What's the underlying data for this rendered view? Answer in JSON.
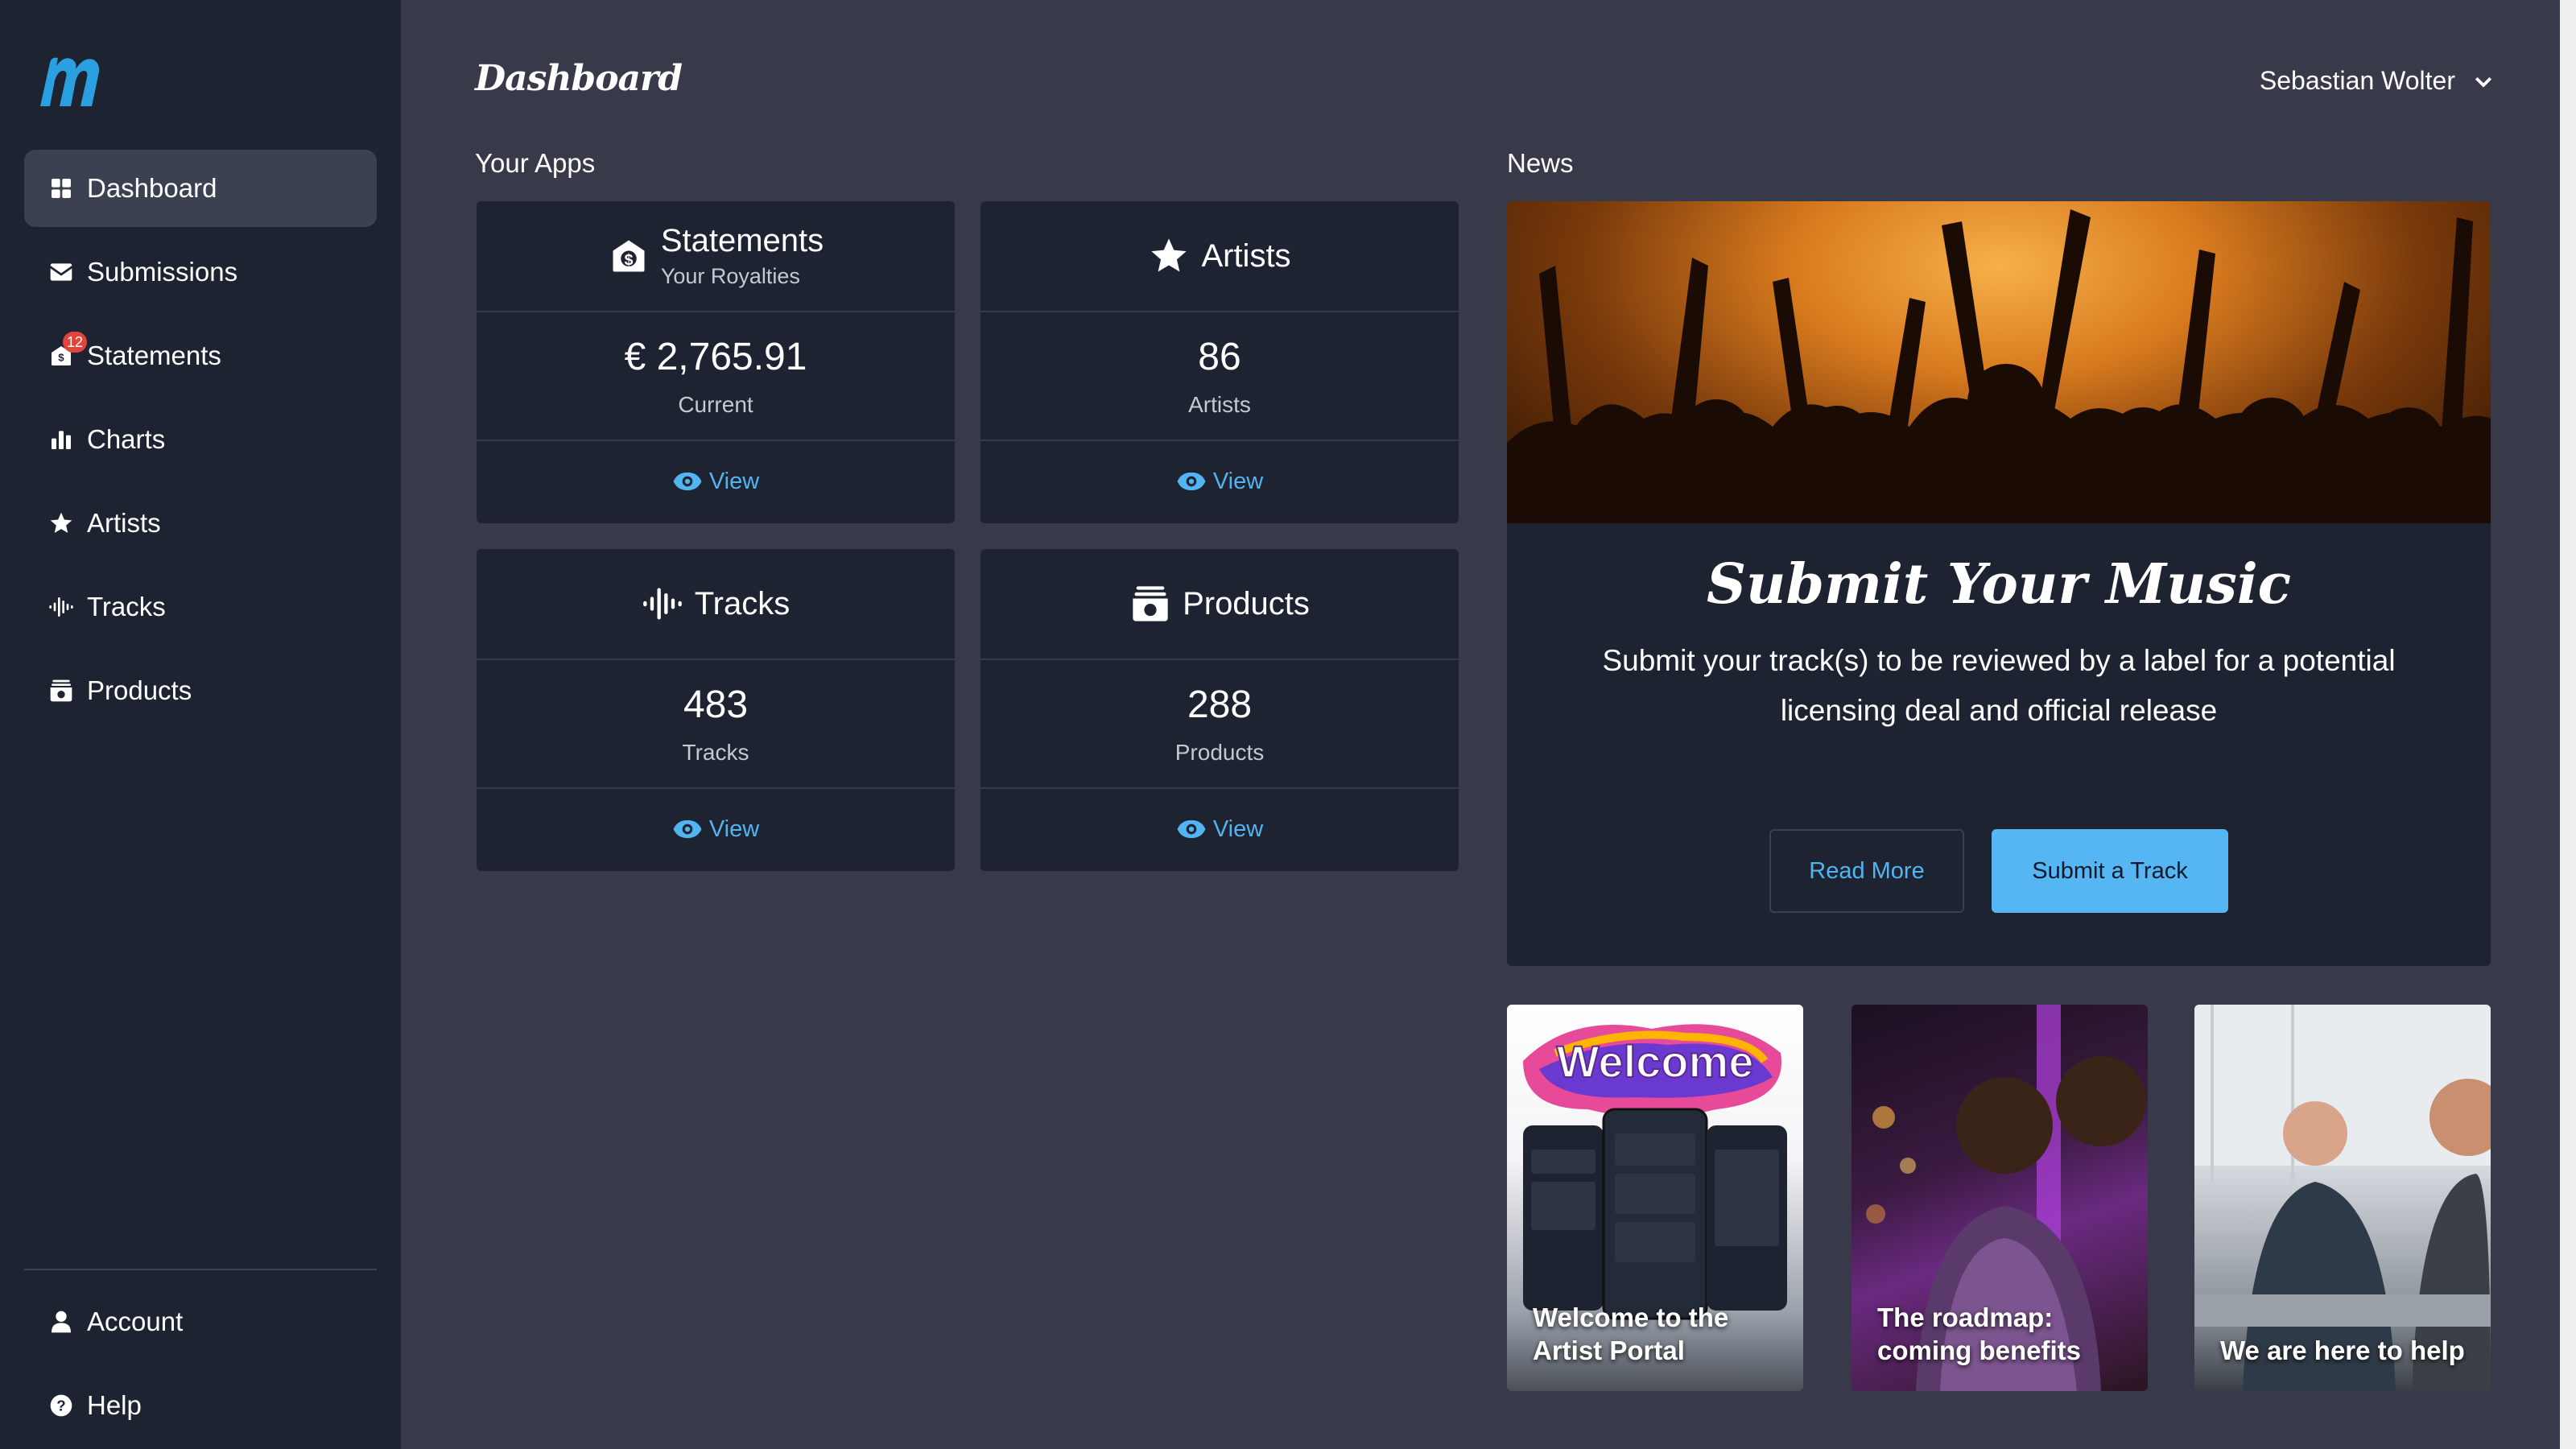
{
  "app": {
    "logo_text": "m"
  },
  "sidebar": {
    "items": [
      {
        "label": "Dashboard",
        "icon": "grid-icon",
        "active": true
      },
      {
        "label": "Submissions",
        "icon": "envelope-icon"
      },
      {
        "label": "Statements",
        "icon": "money-envelope-icon",
        "badge": "12"
      },
      {
        "label": "Charts",
        "icon": "bar-chart-icon"
      },
      {
        "label": "Artists",
        "icon": "star-icon"
      },
      {
        "label": "Tracks",
        "icon": "waveform-icon"
      },
      {
        "label": "Products",
        "icon": "box-icon"
      }
    ],
    "bottom": [
      {
        "label": "Account",
        "icon": "user-icon"
      },
      {
        "label": "Help",
        "icon": "help-icon"
      }
    ]
  },
  "header": {
    "title": "Dashboard",
    "user_name": "Sebastian Wolter"
  },
  "apps": {
    "section_label": "Your Apps",
    "cards": [
      {
        "title": "Statements",
        "subtitle": "Your Royalties",
        "value": "€ 2,765.91",
        "value_label": "Current",
        "action": "View",
        "icon": "money-envelope-icon"
      },
      {
        "title": "Artists",
        "value": "86",
        "value_label": "Artists",
        "action": "View",
        "icon": "star-icon"
      },
      {
        "title": "Tracks",
        "value": "483",
        "value_label": "Tracks",
        "action": "View",
        "icon": "waveform-icon"
      },
      {
        "title": "Products",
        "value": "288",
        "value_label": "Products",
        "action": "View",
        "icon": "box-icon"
      }
    ]
  },
  "news": {
    "section_label": "News",
    "heading": "Submit Your Music",
    "text": "Submit your track(s) to be reviewed by a label for a potential licensing deal and official release",
    "read_more": "Read More",
    "submit": "Submit a Track",
    "articles": [
      {
        "caption": "Welcome to the Artist Portal",
        "image_text": "Welcome"
      },
      {
        "caption": "The roadmap: coming benefits"
      },
      {
        "caption": "We are here to help"
      }
    ]
  },
  "colors": {
    "accent": "#53b4f2",
    "primary_button": "#56b6f4",
    "sidebar": "#1d2330",
    "background": "#383a4a",
    "badge": "#e0443a"
  }
}
